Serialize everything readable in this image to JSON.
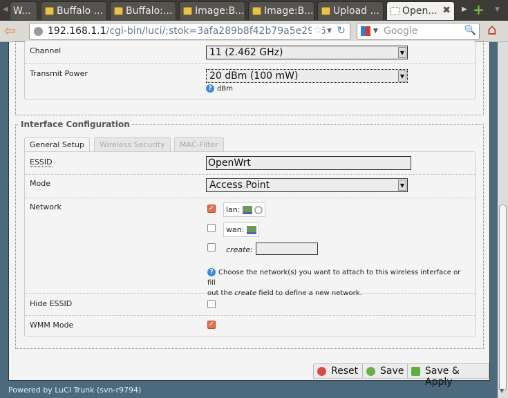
{
  "browser": {
    "tabs": [
      {
        "label": "W..."
      },
      {
        "label": "Buffalo ..."
      },
      {
        "label": "Buffalo:..."
      },
      {
        "label": "Image:B..."
      },
      {
        "label": "Image:B..."
      },
      {
        "label": "Upload ..."
      },
      {
        "label": "Open..."
      }
    ],
    "url_host": "192.168.1.1",
    "url_path": "/cgi-bin/luci/;stok=3afa289b8f42b79a5e29e6",
    "search_placeholder": "Google"
  },
  "wireless": {
    "channel_label": "Channel",
    "channel_value": "11 (2.462 GHz)",
    "txpower_label": "Transmit Power",
    "txpower_value": "20 dBm (100 mW)",
    "txpower_help": "dBm"
  },
  "iface": {
    "legend": "Interface Configuration",
    "tabs": [
      {
        "label": "General Setup"
      },
      {
        "label": "Wireless Security"
      },
      {
        "label": "MAC-Filter"
      }
    ],
    "essid_label": "ESSID",
    "essid_value": "OpenWrt",
    "mode_label": "Mode",
    "mode_value": "Access Point",
    "network_label": "Network",
    "networks": [
      {
        "name": "lan:",
        "checked": true
      },
      {
        "name": "wan:",
        "checked": false
      }
    ],
    "create_label": "create:",
    "network_help_1": "Choose the network(s) you want to attach to this wireless interface or fill",
    "network_help_2a": "out the ",
    "network_help_2b": "create",
    "network_help_2c": " field to define a new network.",
    "hide_essid_label": "Hide ESSID",
    "hide_essid_checked": false,
    "wmm_label": "WMM Mode",
    "wmm_checked": true
  },
  "buttons": {
    "reset": "Reset",
    "save": "Save",
    "save_apply": "Save & Apply"
  },
  "footer": "Powered by LuCI Trunk (svn-r9794)"
}
